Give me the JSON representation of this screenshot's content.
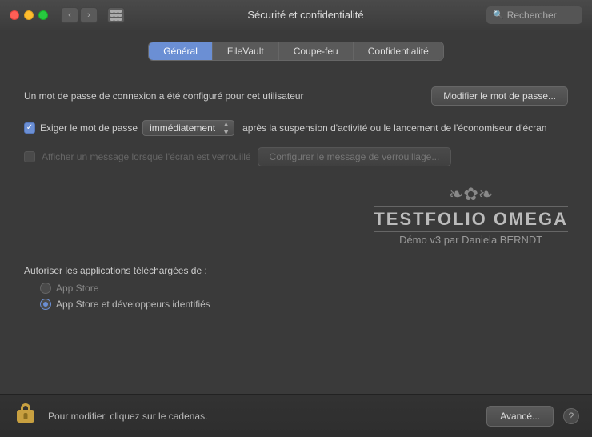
{
  "titleBar": {
    "title": "Sécurité et confidentialité",
    "search_placeholder": "Rechercher"
  },
  "tabs": {
    "items": [
      {
        "label": "Général",
        "active": true
      },
      {
        "label": "FileVault",
        "active": false
      },
      {
        "label": "Coupe-feu",
        "active": false
      },
      {
        "label": "Confidentialité",
        "active": false
      }
    ]
  },
  "content": {
    "password_configured_text": "Un mot de passe de connexion a été configuré pour cet utilisateur",
    "modify_password_btn": "Modifier le mot de passe...",
    "require_password_label": "Exiger le mot de passe",
    "immediately_option": "immédiatement",
    "after_suspend_text": "après la suspension d'activité ou le lancement de l'économiseur d'écran",
    "show_message_label": "Afficher un message lorsque l'écran est verrouillé",
    "configure_message_btn": "Configurer le message de verrouillage...",
    "watermark_ornament": "❧✿❧",
    "watermark_title": "TESTFOLIO OMEGA",
    "watermark_subtitle": "Démo v3 par Daniela BERNDT",
    "apps_section_label": "Autoriser les applications téléchargées de :",
    "radio_options": [
      {
        "label": "App Store",
        "selected": false
      },
      {
        "label": "App Store et développeurs identifiés",
        "selected": true
      }
    ]
  },
  "bottomBar": {
    "lock_text": "Pour modifier, cliquez sur le cadenas.",
    "advanced_btn": "Avancé...",
    "help_label": "?"
  }
}
